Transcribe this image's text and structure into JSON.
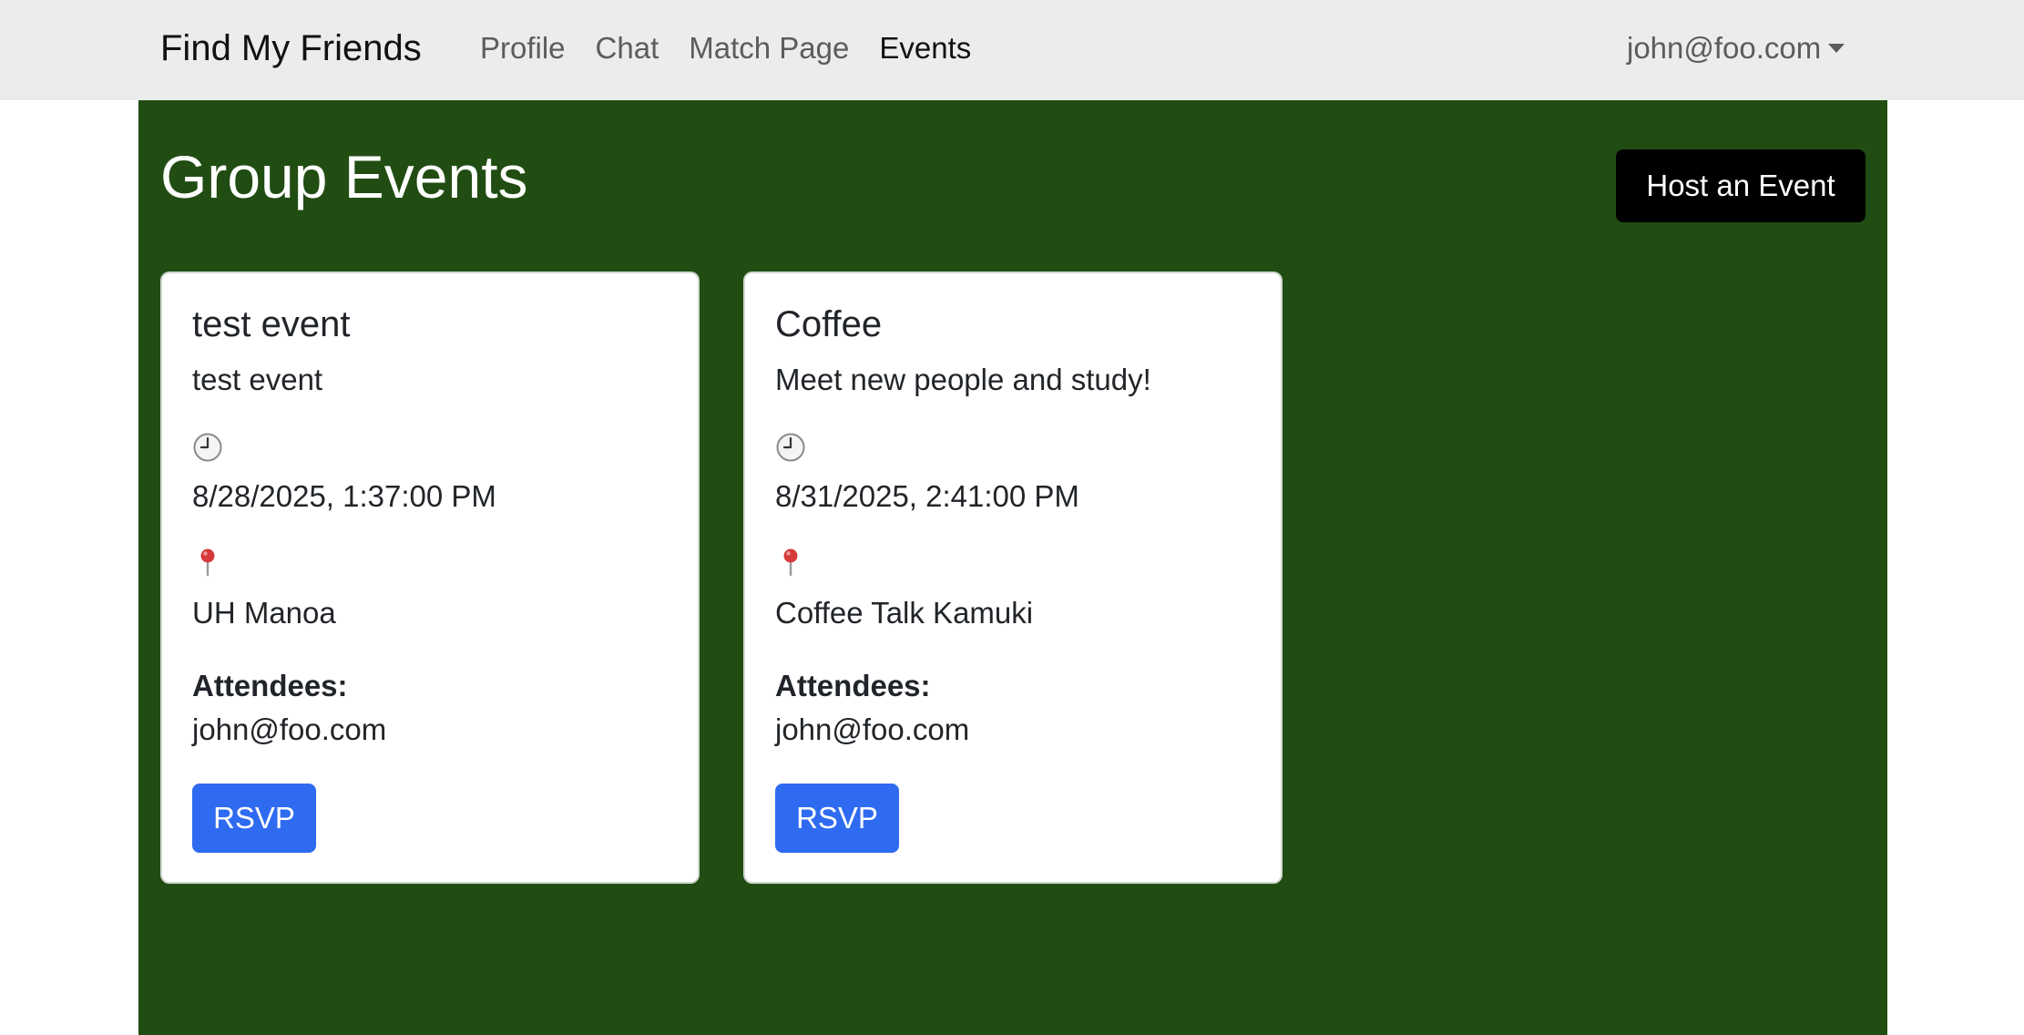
{
  "navbar": {
    "brand": "Find My Friends",
    "links": [
      {
        "label": "Profile",
        "active": false
      },
      {
        "label": "Chat",
        "active": false
      },
      {
        "label": "Match Page",
        "active": false
      },
      {
        "label": "Events",
        "active": true
      }
    ],
    "user_email": "john@foo.com",
    "user_menu_icon": "caret-down-icon"
  },
  "main": {
    "title": "Group Events",
    "host_button_label": "Host an Event",
    "background_color": "#214d13",
    "events": [
      {
        "title": "test event",
        "description": "test event",
        "time_icon": "clock-icon",
        "datetime": "8/28/2025, 1:37:00 PM",
        "location_icon": "pushpin-icon",
        "location": "UH Manoa",
        "attendees_label": "Attendees:",
        "attendees": "john@foo.com",
        "rsvp_label": "RSVP"
      },
      {
        "title": "Coffee",
        "description": "Meet new people and study!",
        "time_icon": "clock-icon",
        "datetime": "8/31/2025, 2:41:00 PM",
        "location_icon": "pushpin-icon",
        "location": "Coffee Talk Kamuki",
        "attendees_label": "Attendees:",
        "attendees": "john@foo.com",
        "rsvp_label": "RSVP"
      }
    ]
  },
  "colors": {
    "navbar_bg": "#ececec",
    "host_button_bg": "#000000",
    "rsvp_button_bg": "#2f6bf0"
  }
}
